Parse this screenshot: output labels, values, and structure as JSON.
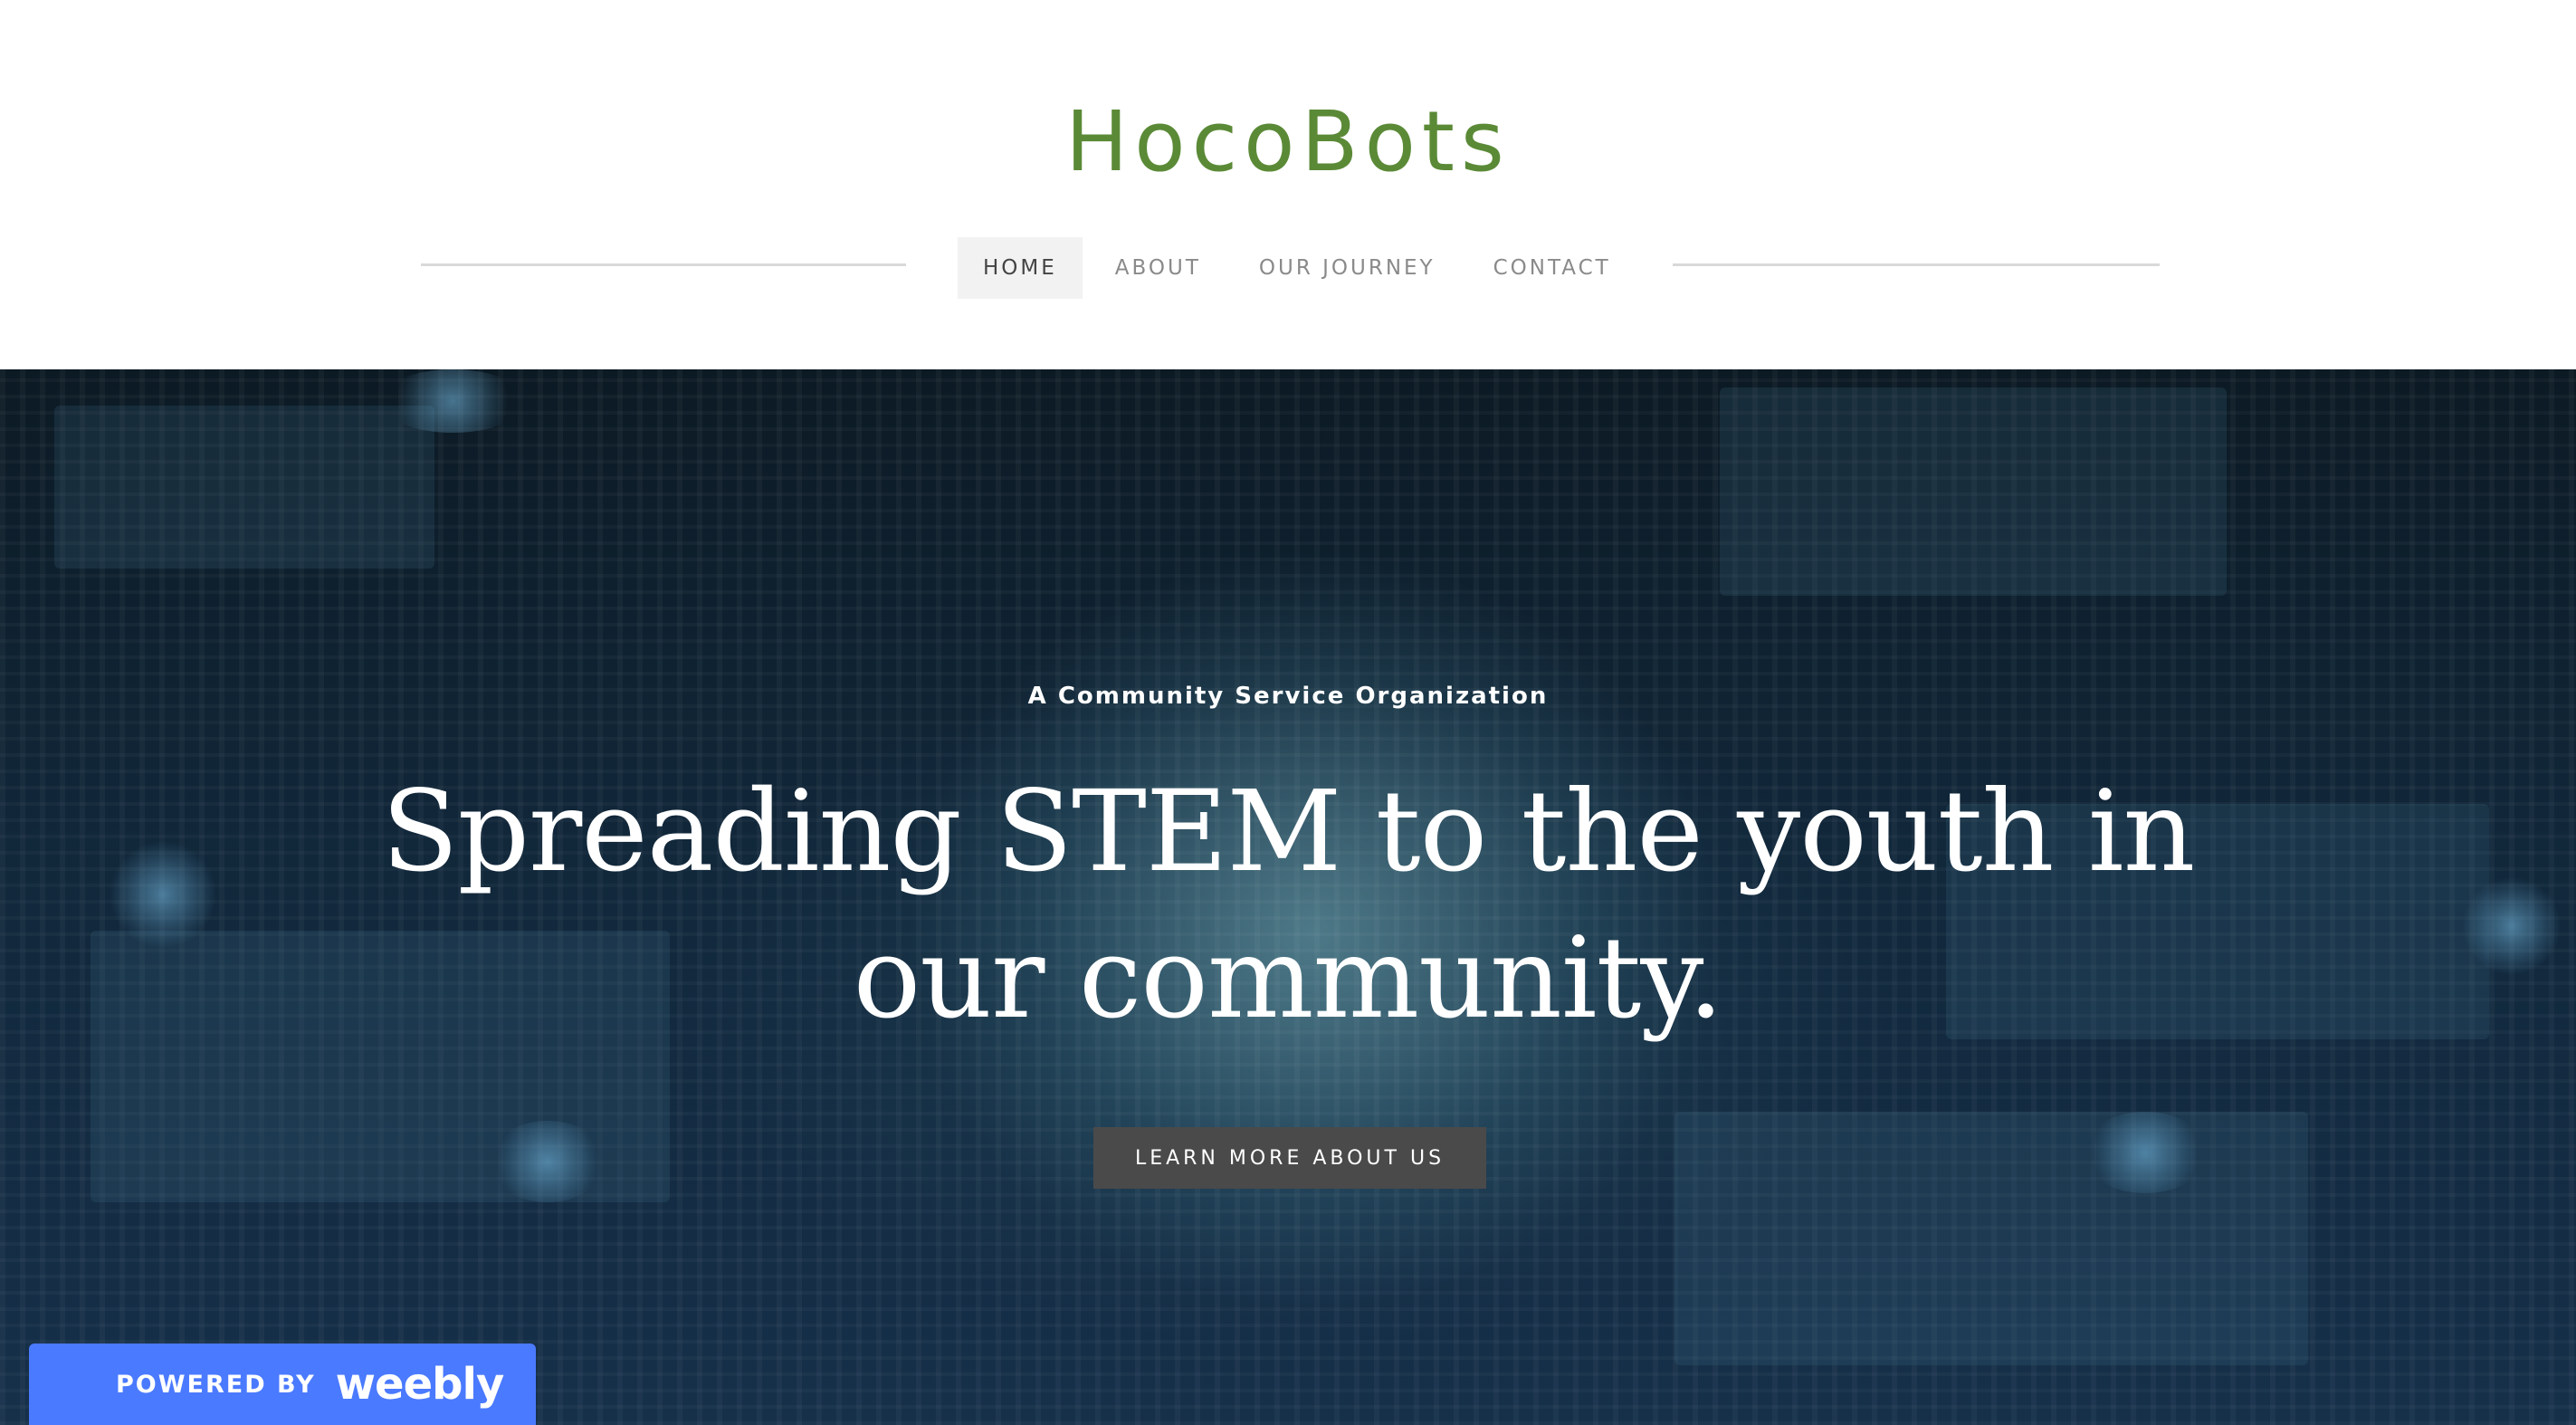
{
  "header": {
    "site_title": "HocoBots",
    "title_color": "#5b8a37"
  },
  "nav": {
    "items": [
      {
        "label": "HOME",
        "active": true
      },
      {
        "label": "ABOUT",
        "active": false
      },
      {
        "label": "OUR JOURNEY",
        "active": false
      },
      {
        "label": "CONTACT",
        "active": false
      }
    ]
  },
  "hero": {
    "subtitle": "A Community Service Organization",
    "title": "Spreading STEM to the youth in our community.",
    "cta_label": "LEARN MORE ABOUT US"
  },
  "badge": {
    "powered_label": "POWERED BY",
    "brand": "weebly",
    "color": "#4a7aff"
  }
}
